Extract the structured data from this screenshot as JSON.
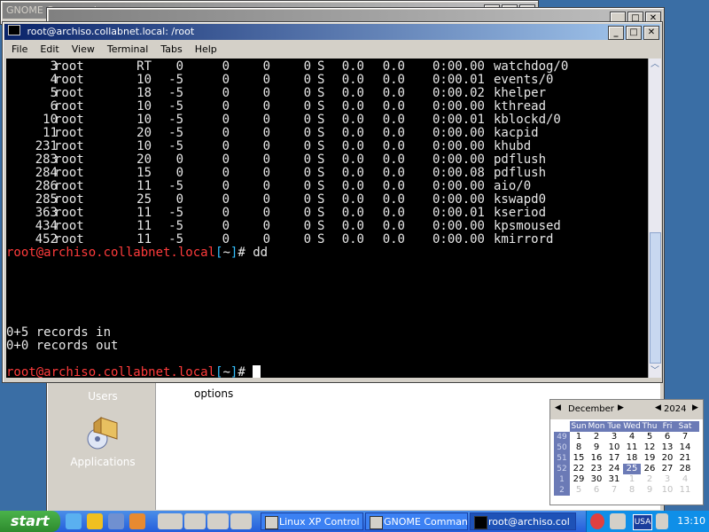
{
  "gc_window": {
    "title": "GNOME Commander"
  },
  "control_panel": {
    "categories": [
      {
        "label": "Users",
        "icon": "users-icon"
      },
      {
        "label": "Applications",
        "icon": "applications-icon"
      }
    ],
    "item_labels": [
      "options"
    ]
  },
  "terminal": {
    "title": "root@archiso.collabnet.local: /root",
    "menu": [
      "File",
      "Edit",
      "View",
      "Terminal",
      "Tabs",
      "Help"
    ],
    "processes": [
      {
        "pid": "3",
        "user": "root",
        "pr": "RT",
        "ni": "0",
        "virt": "0",
        "res": "0",
        "shr": "0",
        "s": "S",
        "cpu": "0.0",
        "mem": "0.0",
        "time": "0:00.00",
        "cmd": "watchdog/0"
      },
      {
        "pid": "4",
        "user": "root",
        "pr": "10",
        "ni": "-5",
        "virt": "0",
        "res": "0",
        "shr": "0",
        "s": "S",
        "cpu": "0.0",
        "mem": "0.0",
        "time": "0:00.01",
        "cmd": "events/0"
      },
      {
        "pid": "5",
        "user": "root",
        "pr": "18",
        "ni": "-5",
        "virt": "0",
        "res": "0",
        "shr": "0",
        "s": "S",
        "cpu": "0.0",
        "mem": "0.0",
        "time": "0:00.02",
        "cmd": "khelper"
      },
      {
        "pid": "6",
        "user": "root",
        "pr": "10",
        "ni": "-5",
        "virt": "0",
        "res": "0",
        "shr": "0",
        "s": "S",
        "cpu": "0.0",
        "mem": "0.0",
        "time": "0:00.00",
        "cmd": "kthread"
      },
      {
        "pid": "10",
        "user": "root",
        "pr": "10",
        "ni": "-5",
        "virt": "0",
        "res": "0",
        "shr": "0",
        "s": "S",
        "cpu": "0.0",
        "mem": "0.0",
        "time": "0:00.01",
        "cmd": "kblockd/0"
      },
      {
        "pid": "11",
        "user": "root",
        "pr": "20",
        "ni": "-5",
        "virt": "0",
        "res": "0",
        "shr": "0",
        "s": "S",
        "cpu": "0.0",
        "mem": "0.0",
        "time": "0:00.00",
        "cmd": "kacpid"
      },
      {
        "pid": "231",
        "user": "root",
        "pr": "10",
        "ni": "-5",
        "virt": "0",
        "res": "0",
        "shr": "0",
        "s": "S",
        "cpu": "0.0",
        "mem": "0.0",
        "time": "0:00.00",
        "cmd": "khubd"
      },
      {
        "pid": "283",
        "user": "root",
        "pr": "20",
        "ni": "0",
        "virt": "0",
        "res": "0",
        "shr": "0",
        "s": "S",
        "cpu": "0.0",
        "mem": "0.0",
        "time": "0:00.00",
        "cmd": "pdflush"
      },
      {
        "pid": "284",
        "user": "root",
        "pr": "15",
        "ni": "0",
        "virt": "0",
        "res": "0",
        "shr": "0",
        "s": "S",
        "cpu": "0.0",
        "mem": "0.0",
        "time": "0:00.08",
        "cmd": "pdflush"
      },
      {
        "pid": "286",
        "user": "root",
        "pr": "11",
        "ni": "-5",
        "virt": "0",
        "res": "0",
        "shr": "0",
        "s": "S",
        "cpu": "0.0",
        "mem": "0.0",
        "time": "0:00.00",
        "cmd": "aio/0"
      },
      {
        "pid": "285",
        "user": "root",
        "pr": "25",
        "ni": "0",
        "virt": "0",
        "res": "0",
        "shr": "0",
        "s": "S",
        "cpu": "0.0",
        "mem": "0.0",
        "time": "0:00.00",
        "cmd": "kswapd0"
      },
      {
        "pid": "363",
        "user": "root",
        "pr": "11",
        "ni": "-5",
        "virt": "0",
        "res": "0",
        "shr": "0",
        "s": "S",
        "cpu": "0.0",
        "mem": "0.0",
        "time": "0:00.01",
        "cmd": "kseriod"
      },
      {
        "pid": "434",
        "user": "root",
        "pr": "11",
        "ni": "-5",
        "virt": "0",
        "res": "0",
        "shr": "0",
        "s": "S",
        "cpu": "0.0",
        "mem": "0.0",
        "time": "0:00.00",
        "cmd": "kpsmoused"
      },
      {
        "pid": "452",
        "user": "root",
        "pr": "11",
        "ni": "-5",
        "virt": "0",
        "res": "0",
        "shr": "0",
        "s": "S",
        "cpu": "0.0",
        "mem": "0.0",
        "time": "0:00.00",
        "cmd": "kmirrord"
      }
    ],
    "prompt_host": "root@archiso.collabnet.local",
    "prompt_dir_open": "[",
    "prompt_dir": "~",
    "prompt_dir_close": "]",
    "prompt_hash": "#",
    "command_1": " dd",
    "output_1": "0+5 records in",
    "output_2": "0+0 records out",
    "command_2": " "
  },
  "calendar": {
    "month": "December",
    "year": "2024",
    "weekdays": [
      "Sun",
      "Mon",
      "Tue",
      "Wed",
      "Thu",
      "Fri",
      "Sat"
    ],
    "weeks": [
      {
        "wk": "49",
        "days": [
          "1",
          "2",
          "3",
          "4",
          "5",
          "6",
          "7"
        ]
      },
      {
        "wk": "50",
        "days": [
          "8",
          "9",
          "10",
          "11",
          "12",
          "13",
          "14"
        ]
      },
      {
        "wk": "51",
        "days": [
          "15",
          "16",
          "17",
          "18",
          "19",
          "20",
          "21"
        ]
      },
      {
        "wk": "52",
        "days": [
          "22",
          "23",
          "24",
          "25",
          "26",
          "27",
          "28"
        ]
      },
      {
        "wk": "1",
        "days": [
          "29",
          "30",
          "31",
          "1",
          "2",
          "3",
          "4"
        ]
      },
      {
        "wk": "2",
        "days": [
          "5",
          "6",
          "7",
          "8",
          "9",
          "10",
          "11"
        ]
      }
    ],
    "today": "25"
  },
  "taskbar": {
    "start_label": "start",
    "tasks": [
      {
        "label": "Linux XP Control",
        "icon": "control-panel-icon"
      },
      {
        "label": "GNOME Commander",
        "icon": "gnome-commander-icon"
      },
      {
        "label": "root@archiso.col",
        "icon": "terminal-icon"
      }
    ],
    "language": "USA",
    "clock": "13:10"
  },
  "colors": {
    "prompt_host": "#ff3b3b",
    "prompt_dir": "#33c0ff",
    "desktop": "#3a6ea5",
    "taskbar": "#245edb"
  }
}
